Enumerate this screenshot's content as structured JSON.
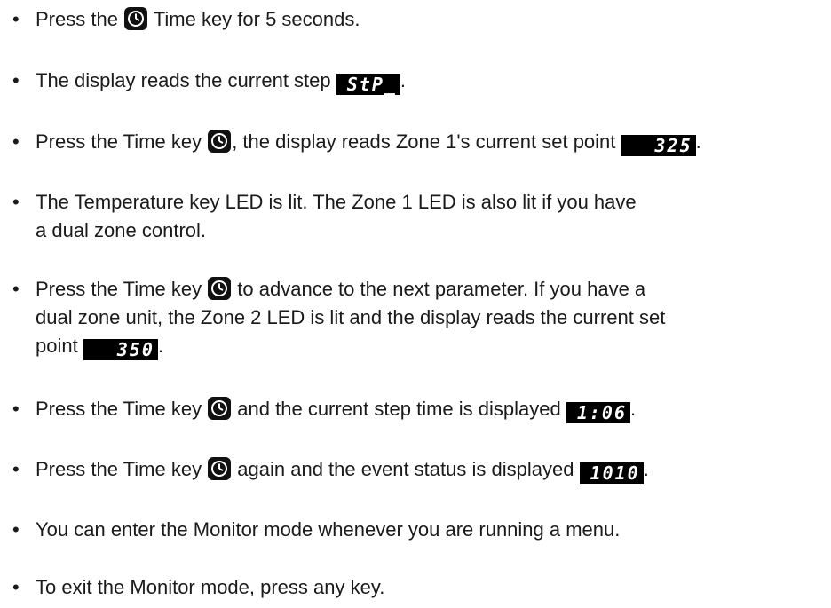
{
  "bullet": "•",
  "icons": {
    "time_key": "clock-icon"
  },
  "items": [
    {
      "before": "Press the ",
      "after": " Time key for 5 seconds."
    },
    {
      "before": "The display reads the current step ",
      "lcd": "StP_",
      "after": "."
    },
    {
      "before": "Press the Time key ",
      "middle": ", the display reads Zone 1's current set point ",
      "lcd": "325",
      "after": "."
    },
    {
      "line1": "The Temperature key LED is lit.  The Zone 1 LED is also lit if you have",
      "line2": "a dual zone control."
    },
    {
      "before": "Press the Time key ",
      "middle1": " to advance to the next parameter.  If you have a",
      "line2": "dual zone unit, the Zone 2 LED is lit and the display reads the current set",
      "line3_before": "point ",
      "lcd": "350",
      "after": "."
    },
    {
      "before": "Press the Time key ",
      "middle": " and the current step time is displayed ",
      "lcd": "1:06",
      "after": "."
    },
    {
      "before": "Press the Time key ",
      "middle": " again and the event status is displayed ",
      "lcd": "1010",
      "after": "."
    },
    {
      "text": "You can enter the Monitor mode whenever you are running a menu."
    },
    {
      "text": "To exit the Monitor mode, press any key."
    }
  ]
}
